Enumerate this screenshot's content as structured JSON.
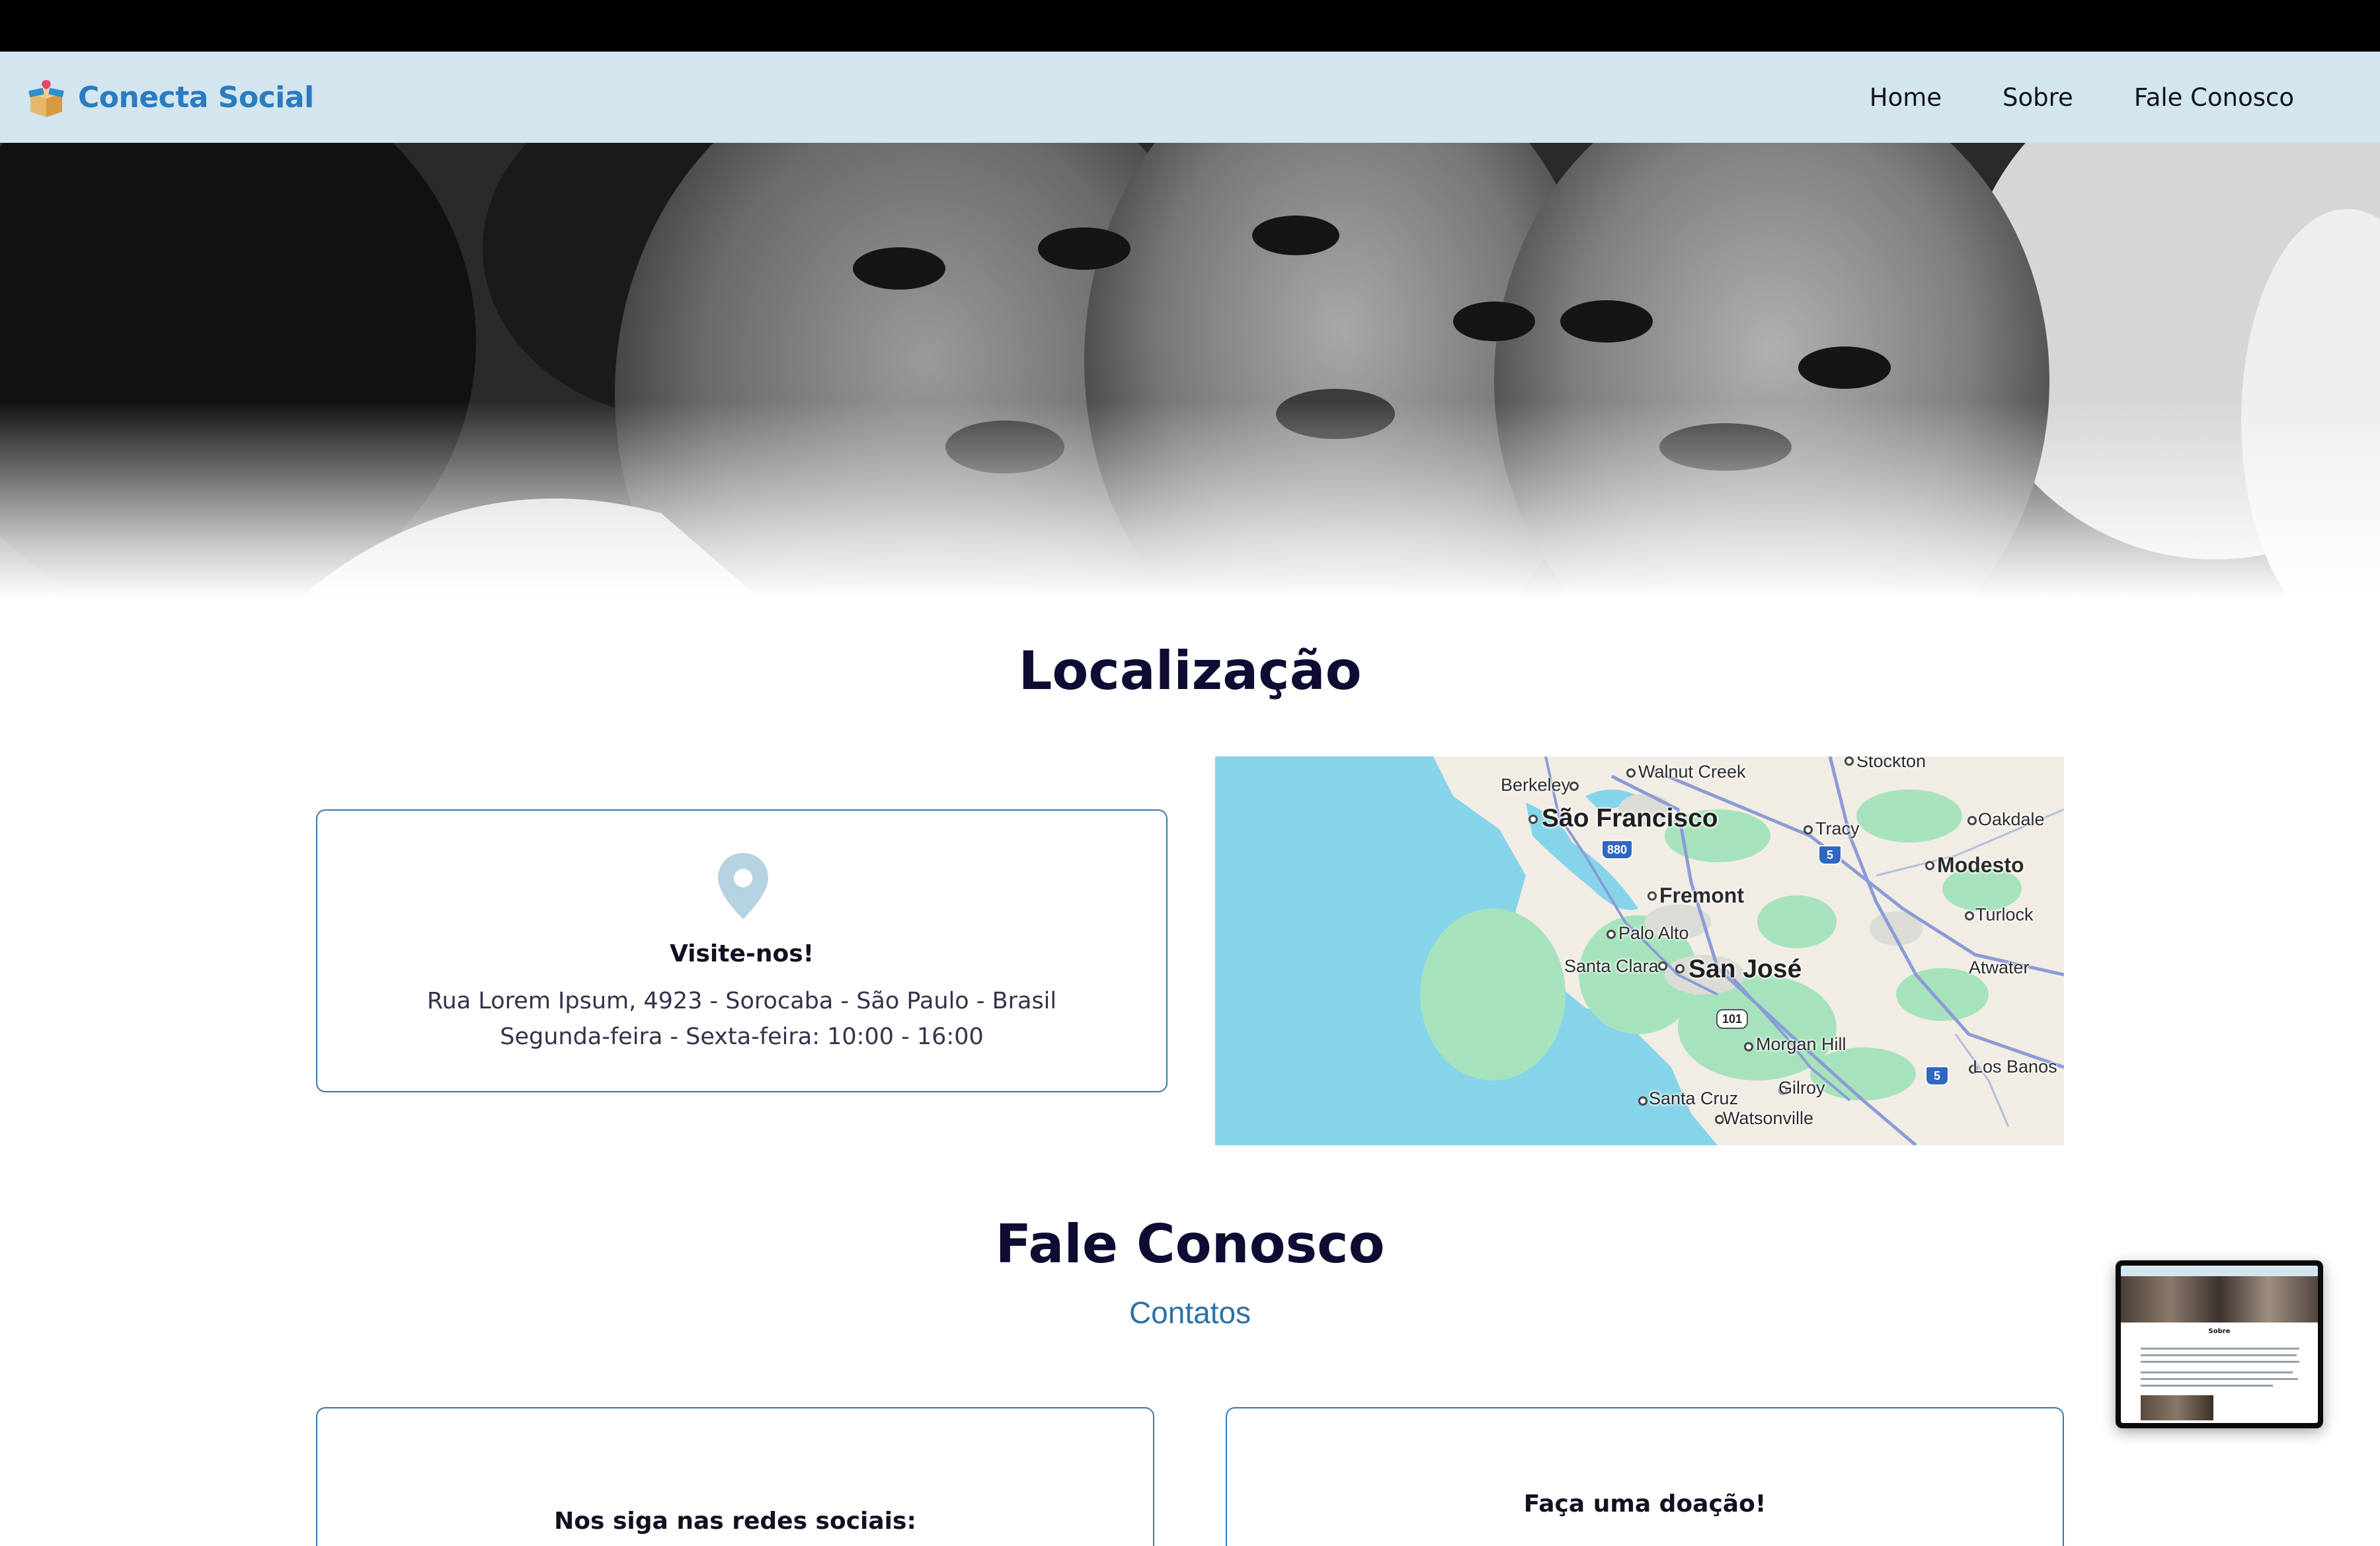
{
  "brand": {
    "name": "Conecta Social"
  },
  "nav": {
    "items": [
      "Home",
      "Sobre",
      "Fale Conosco"
    ]
  },
  "location": {
    "title": "Localização",
    "card_heading": "Visite-nos!",
    "address": "Rua Lorem Ipsum, 4923 - Sorocaba - São Paulo - Brasil",
    "hours": "Segunda-feira - Sexta-feira: 10:00 - 16:00"
  },
  "map": {
    "labels": {
      "stockton": "Stockton",
      "walnut_creek": "Walnut Creek",
      "berkeley": "Berkeley",
      "sao_francisco": "São Francisco",
      "tracy": "Tracy",
      "oakdale": "Oakdale",
      "modesto": "Modesto",
      "fremont": "Fremont",
      "turlock": "Turlock",
      "palo_alto": "Palo Alto",
      "santa_clara": "Santa Clara",
      "san_jose": "San José",
      "atwater": "Atwater",
      "morgan_hill": "Morgan Hill",
      "gilroy": "Gilroy",
      "los_banos": "Los Banos",
      "santa_cruz": "Santa Cruz",
      "watsonville": "Watsonville"
    },
    "shields": {
      "i880": "880",
      "i5_north": "5",
      "i5_south": "5",
      "us101": "101"
    }
  },
  "contact": {
    "title": "Fale Conosco",
    "subtitle": "Contatos",
    "social_heading": "Nos siga nas redes sociais:",
    "donate_heading": "Faça uma doação!"
  },
  "preview": {
    "title": "Sobre"
  },
  "colors": {
    "navbar": "#d3e5ee",
    "brand": "#2a7bbf",
    "accent": "#3a78a8",
    "title": "#0d0d33",
    "water": "#86d4ea",
    "land": "#f1ede4",
    "green": "#a6e3bd"
  }
}
